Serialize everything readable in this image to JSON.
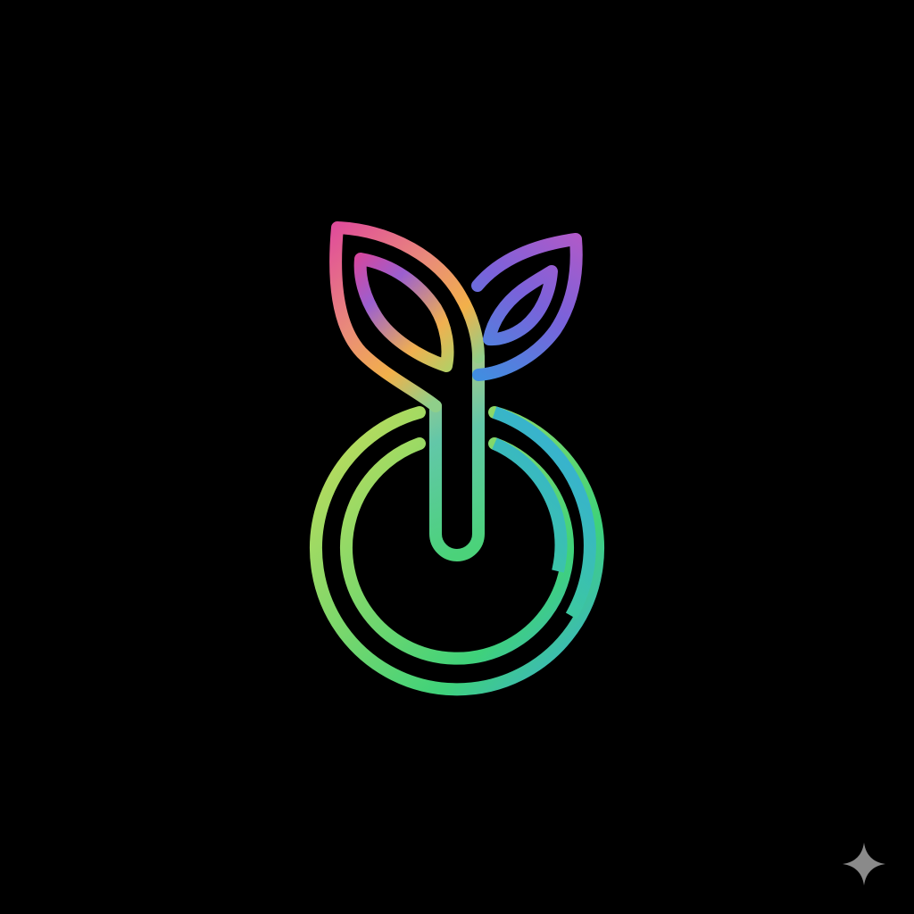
{
  "canvas": {
    "background": "#000000"
  },
  "logo": {
    "icon": "sprout-power-icon",
    "colors": {
      "magenta": "#e0499c",
      "orange": "#f2b04a",
      "purple": "#8a5cd6",
      "blue": "#3aa0e0",
      "yellow_green": "#b4d85a",
      "green": "#3ed27a"
    }
  },
  "watermark": {
    "icon": "sparkle-icon",
    "color": "#8a8a8a"
  }
}
